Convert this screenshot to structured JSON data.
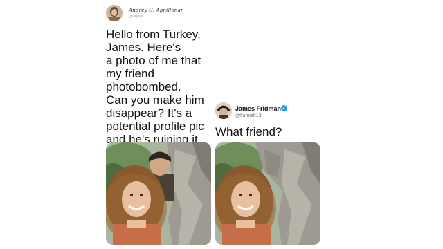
{
  "tweet1": {
    "display_name": "Andrey G. Agnillonan",
    "handle": "@Ifeyela",
    "text": "Hello from Turkey,\nJames. Here's\na photo of me that\nmy friend\nphotobombed.\nCan you make him\ndisappear? It's a\npotential profile pic\nand he's ruining it.",
    "photo_icon": "photo-with-friend-image"
  },
  "tweet2": {
    "display_name": "James Fridman",
    "handle": "@fjamie013",
    "verified_icon": "verified-badge-icon",
    "text": "What friend?",
    "photo_icon": "photo-edited-image"
  },
  "colors": {
    "verified": "#1d9bf0",
    "text": "#111111",
    "handle": "#6b7178"
  }
}
